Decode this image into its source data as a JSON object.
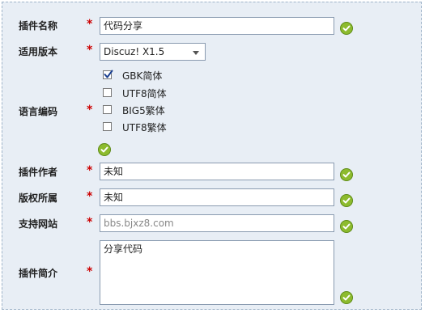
{
  "form": {
    "plugin_name": {
      "label": "插件名称",
      "value": "代码分享"
    },
    "version": {
      "label": "适用版本",
      "selected": "Discuz! X1.5"
    },
    "encoding": {
      "label": "语言编码",
      "options": [
        {
          "label": "GBK简体",
          "checked": true
        },
        {
          "label": "UTF8简体",
          "checked": false
        },
        {
          "label": "BIG5繁体",
          "checked": false
        },
        {
          "label": "UTF8繁体",
          "checked": false
        }
      ]
    },
    "author": {
      "label": "插件作者",
      "value": "未知"
    },
    "copyright": {
      "label": "版权所属",
      "value": "未知"
    },
    "website": {
      "label": "支持网站",
      "placeholder": "bbs.bjxz8.com"
    },
    "intro": {
      "label": "插件简介",
      "value": "分享代码"
    },
    "required_mark": "*"
  },
  "colors": {
    "panel_bg": "#e8eef5",
    "required": "#cc0000",
    "ok_green": "#8dbb2e"
  },
  "icons": [
    "checkmark-circle-icon",
    "dropdown-arrow-icon",
    "checkbox-check-icon"
  ]
}
